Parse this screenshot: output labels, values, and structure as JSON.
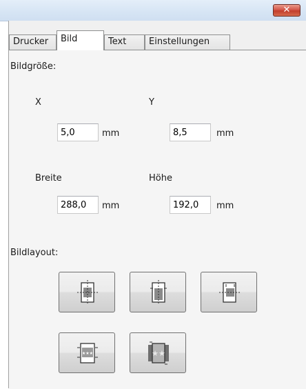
{
  "window": {
    "close_icon": "close-icon"
  },
  "tabs": [
    {
      "label": "Drucker",
      "active": false
    },
    {
      "label": "Bild",
      "active": true
    },
    {
      "label": "Text",
      "active": false
    },
    {
      "label": "Einstellungen",
      "active": false
    }
  ],
  "bildgroesse": {
    "heading": "Bildgröße:",
    "x_label": "X",
    "x_value": "5,0",
    "y_label": "Y",
    "y_value": "8,5",
    "breite_label": "Breite",
    "breite_value": "288,0",
    "hoehe_label": "Höhe",
    "hoehe_value": "192,0",
    "unit": "mm"
  },
  "bildlayout": {
    "heading": "Bildlayout:",
    "buttons": [
      {
        "icon": "layout-center-icon"
      },
      {
        "icon": "layout-fit-height-icon"
      },
      {
        "icon": "layout-fit-width-icon"
      },
      {
        "icon": "layout-framed-stars-icon"
      },
      {
        "icon": "layout-fill-stars-icon"
      }
    ]
  },
  "colors": {
    "close_button": "#c23e2d",
    "titlebar": "#d8e6f5",
    "panel": "#f5f5f5"
  }
}
